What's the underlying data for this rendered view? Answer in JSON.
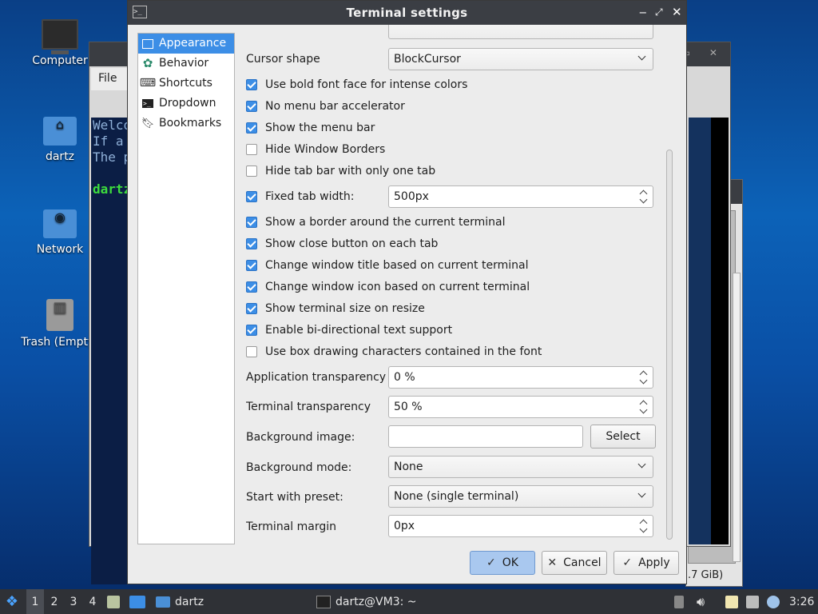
{
  "desktop": {
    "icons": [
      {
        "label": "Computer"
      },
      {
        "label": "dartz"
      },
      {
        "label": "Network"
      },
      {
        "label": "Trash (Empty)"
      }
    ]
  },
  "background_terminal": {
    "menu_label": "File",
    "lines": [
      "Welco",
      "If a",
      "The p",
      "",
      "dartz"
    ]
  },
  "background_window2": {
    "size_text": ".7 GiB)"
  },
  "dialog": {
    "title": "Terminal settings",
    "nav": [
      {
        "label": "Appearance",
        "selected": true,
        "icon": "appearance-icon"
      },
      {
        "label": "Behavior",
        "selected": false,
        "icon": "behavior-gear-icon"
      },
      {
        "label": "Shortcuts",
        "selected": false,
        "icon": "keyboard-icon"
      },
      {
        "label": "Dropdown",
        "selected": false,
        "icon": "terminal-icon"
      },
      {
        "label": "Bookmarks",
        "selected": false,
        "icon": "bookmark-icon"
      }
    ],
    "cursor_shape": {
      "label": "Cursor shape",
      "value": "BlockCursor"
    },
    "checkboxes": [
      {
        "label": "Use bold font face for intense colors",
        "checked": true
      },
      {
        "label": "No menu bar accelerator",
        "checked": true
      },
      {
        "label": "Show the menu bar",
        "checked": true
      },
      {
        "label": "Hide Window Borders",
        "checked": false
      },
      {
        "label": "Hide tab bar with only one tab",
        "checked": false
      }
    ],
    "fixed_tab": {
      "label": "Fixed tab width:",
      "checked": true,
      "value": "500px"
    },
    "checkboxes2": [
      {
        "label": "Show a border around the current terminal",
        "checked": true
      },
      {
        "label": "Show close button on each tab",
        "checked": true
      },
      {
        "label": "Change window title based on current terminal",
        "checked": true
      },
      {
        "label": "Change window icon based on current terminal",
        "checked": true
      },
      {
        "label": "Show terminal size on resize",
        "checked": true
      },
      {
        "label": "Enable bi-directional text support",
        "checked": true
      },
      {
        "label": "Use box drawing characters contained in the font",
        "checked": false
      }
    ],
    "app_transparency": {
      "label": "Application transparency",
      "value": "0 %"
    },
    "term_transparency": {
      "label": "Terminal transparency",
      "value": "50 %"
    },
    "bg_image": {
      "label": "Background image:",
      "value": "",
      "button": "Select"
    },
    "bg_mode": {
      "label": "Background mode:",
      "value": "None"
    },
    "preset": {
      "label": "Start with preset:",
      "value": "None (single terminal)"
    },
    "margin": {
      "label": "Terminal margin",
      "value": "0px"
    },
    "buttons": {
      "ok": "OK",
      "cancel": "Cancel",
      "apply": "Apply"
    }
  },
  "taskbar": {
    "workspaces": [
      "1",
      "2",
      "3",
      "4"
    ],
    "active_workspace": "1",
    "task_folder": "dartz",
    "task_terminal": "dartz@VM3: ~",
    "clock": "3:26"
  },
  "colors": {
    "accent": "#3c8ee6",
    "titlebar": "#3b3e44",
    "taskbar": "#2f3136"
  }
}
